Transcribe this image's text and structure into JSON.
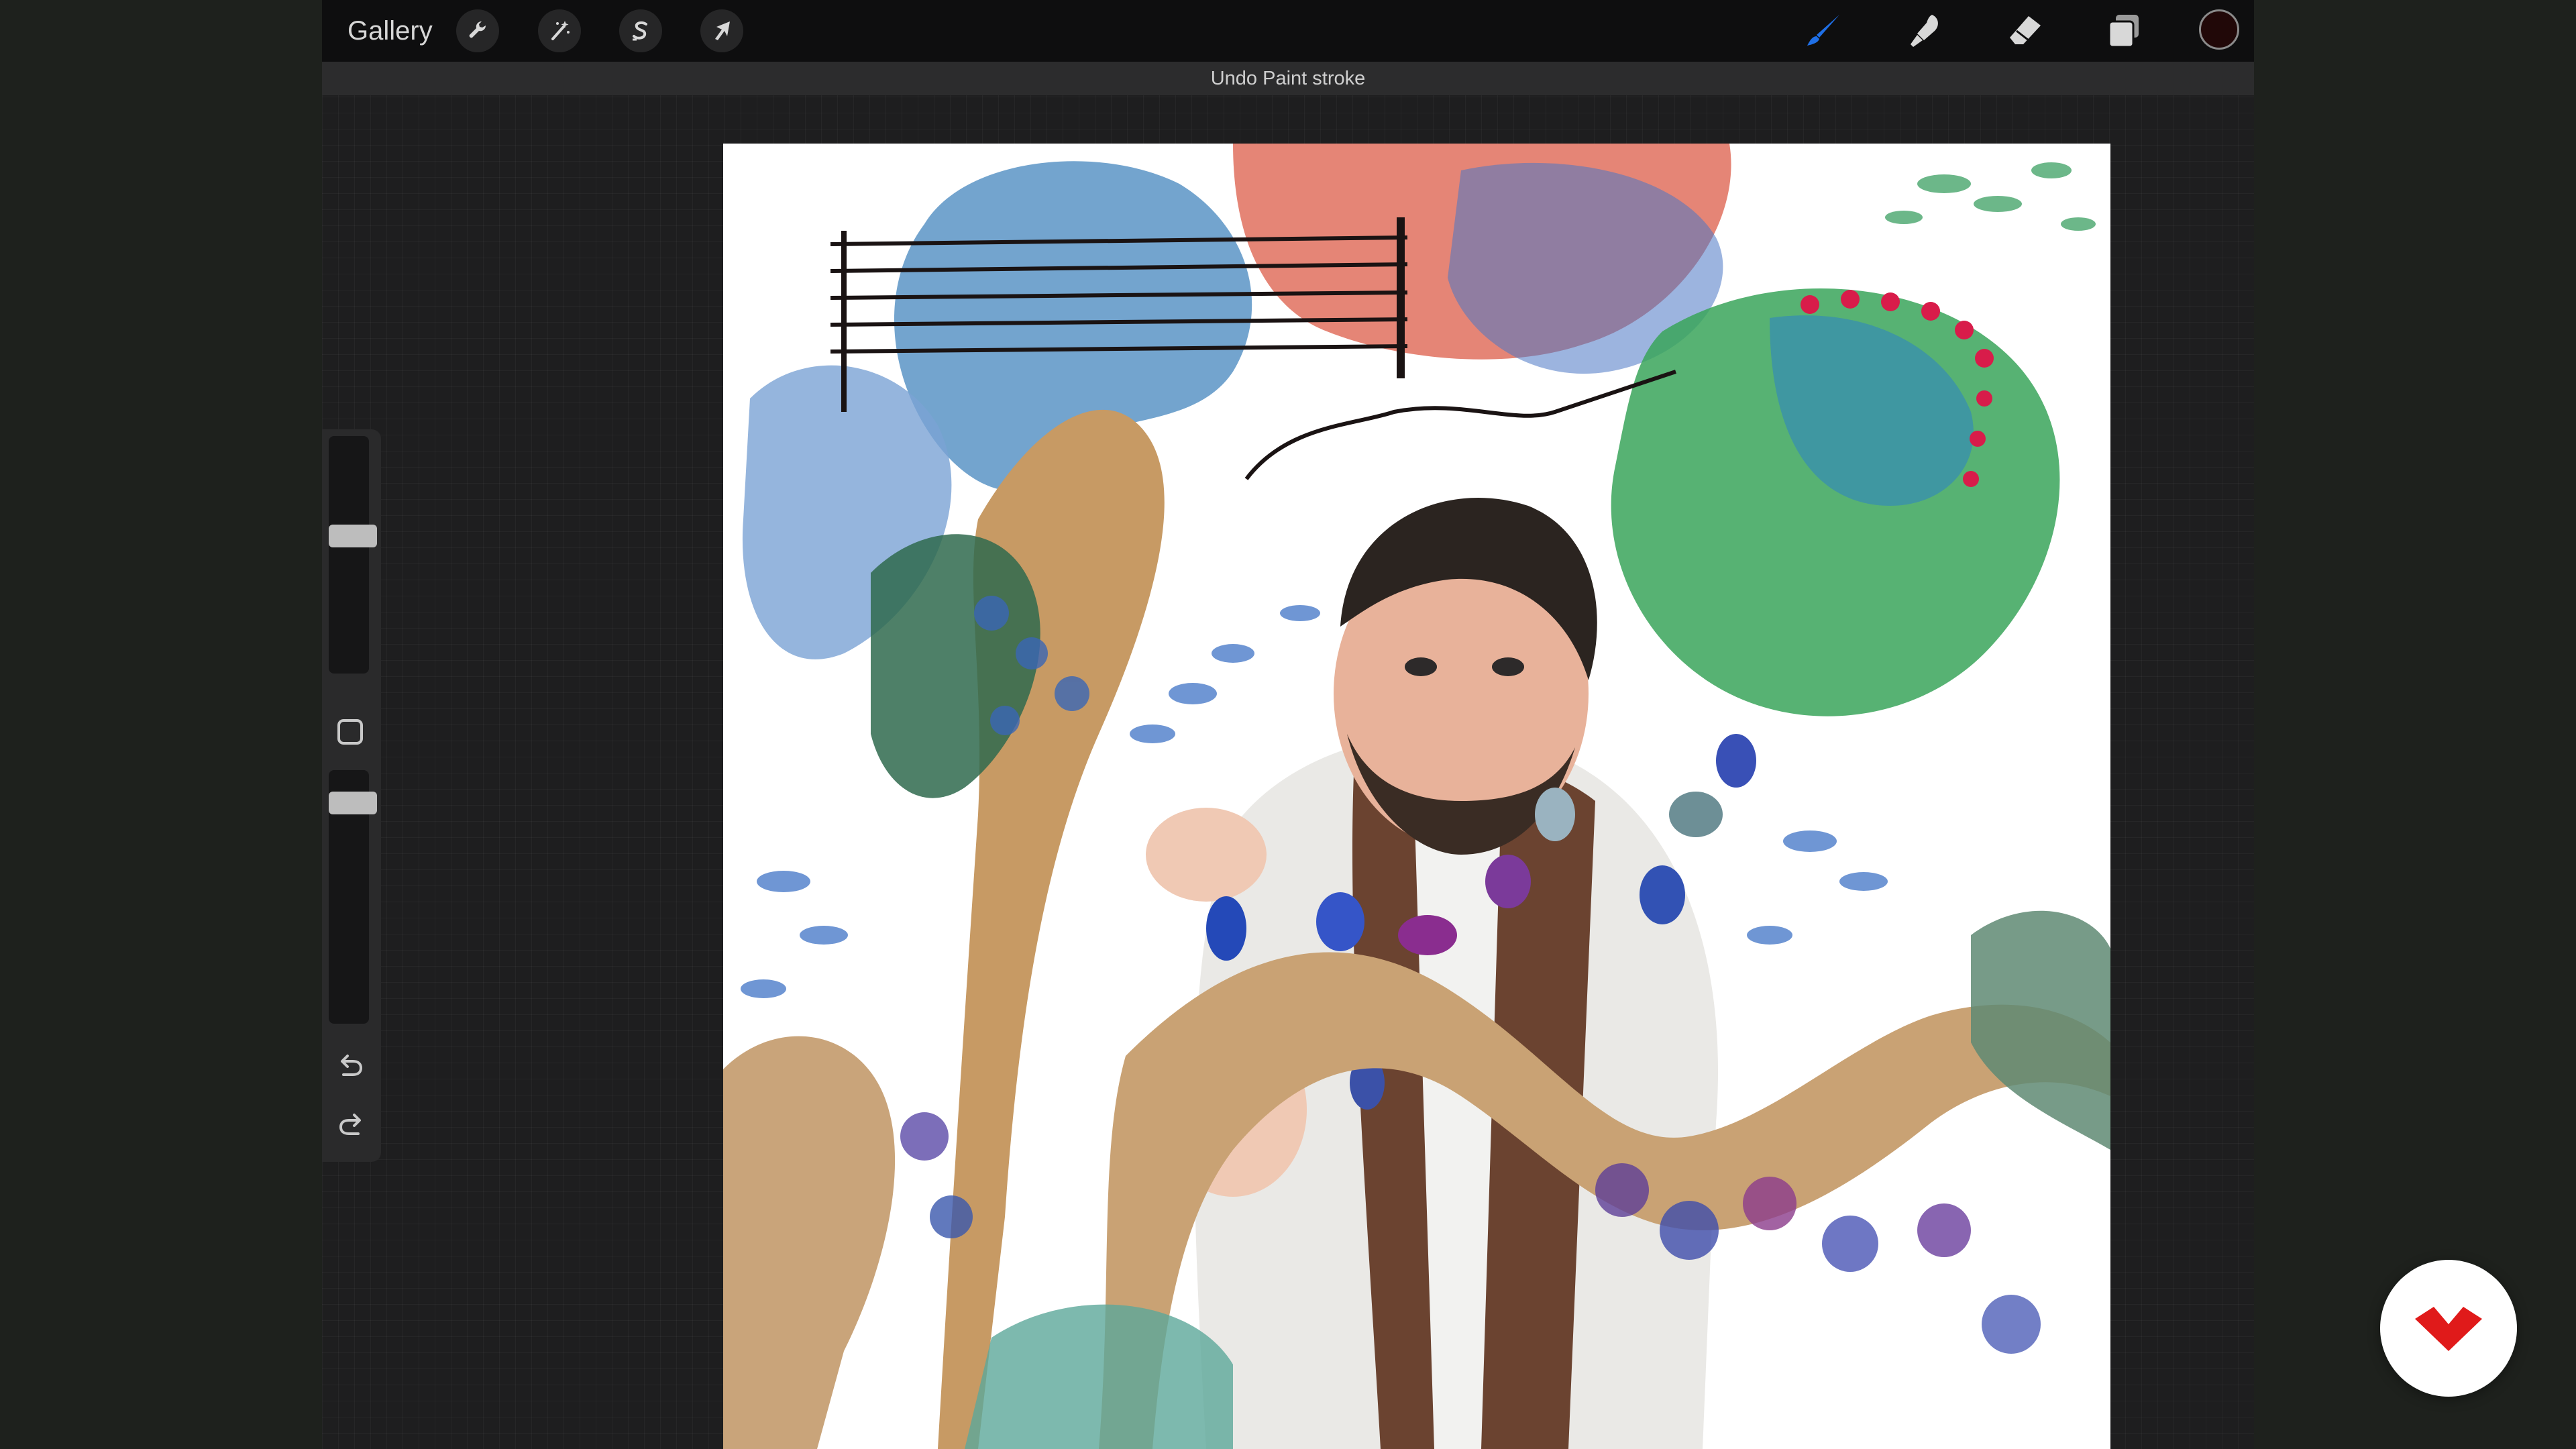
{
  "topbar": {
    "gallery_label": "Gallery",
    "icons": [
      "wrench-icon",
      "magic-wand-icon",
      "selection-s-icon",
      "transform-arrow-icon"
    ],
    "right_tools": [
      "brush-icon",
      "smudge-icon",
      "eraser-icon",
      "layers-icon"
    ],
    "current_color": "#210808",
    "active_tool_color": "#1f6fe6"
  },
  "notification": {
    "text": "Undo Paint stroke"
  },
  "sidebar": {
    "icons": [
      "undo-icon",
      "redo-icon",
      "modify-square-icon"
    ]
  },
  "accent": {
    "fab_color": "#e01a1a"
  }
}
